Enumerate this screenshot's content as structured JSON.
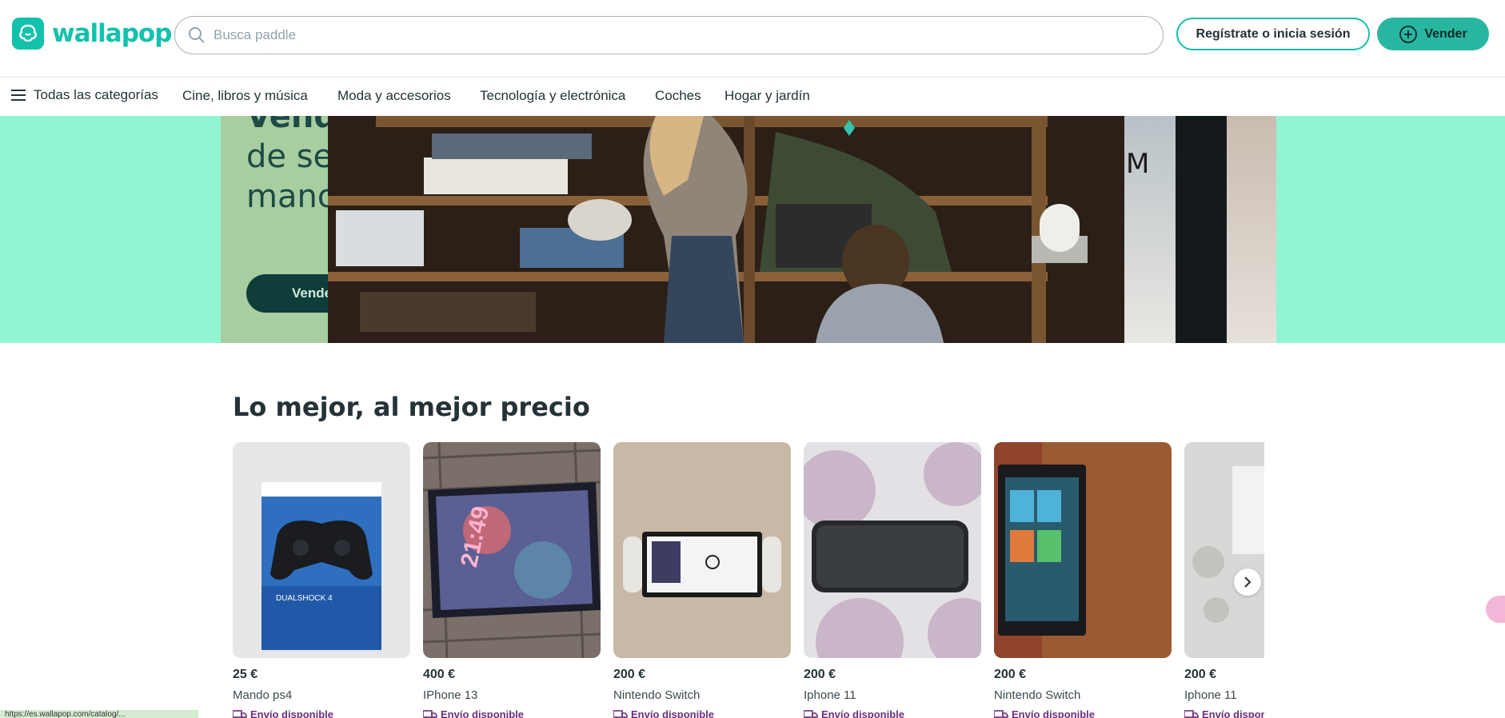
{
  "brand": {
    "name": "wallapop",
    "accent": "#13c1ac"
  },
  "search": {
    "placeholder": "Busca paddle"
  },
  "header": {
    "login_label": "Regístrate o inicia sesión",
    "sell_label": "Vender"
  },
  "categories": {
    "all_label": "Todas las categorías",
    "items": [
      {
        "label": "Cine, libros y música"
      },
      {
        "label": "Moda y accesorios"
      },
      {
        "label": "Tecnología y electrónica"
      },
      {
        "label": "Coches"
      },
      {
        "label": "Hogar y jardín"
      }
    ]
  },
  "hero": {
    "line1": "Vende",
    "line2": "de se",
    "line3": "mano",
    "cta": "Vende",
    "side_text": "M C"
  },
  "section": {
    "title": "Lo mejor, al mejor precio"
  },
  "products": [
    {
      "price": "25 €",
      "name": "Mando ps4",
      "shipping": "Envío disponible"
    },
    {
      "price": "400 €",
      "name": "IPhone 13",
      "shipping": "Envío disponible"
    },
    {
      "price": "200 €",
      "name": "Nintendo Switch",
      "shipping": "Envío disponible"
    },
    {
      "price": "200 €",
      "name": "Iphone 11",
      "shipping": "Envío disponible"
    },
    {
      "price": "200 €",
      "name": "Nintendo Switch",
      "shipping": "Envío disponible"
    },
    {
      "price": "200 €",
      "name": "Iphone 11",
      "shipping": "Envío disponible"
    }
  ],
  "status": {
    "url": "https://es.wallapop.com/catalog/..."
  }
}
